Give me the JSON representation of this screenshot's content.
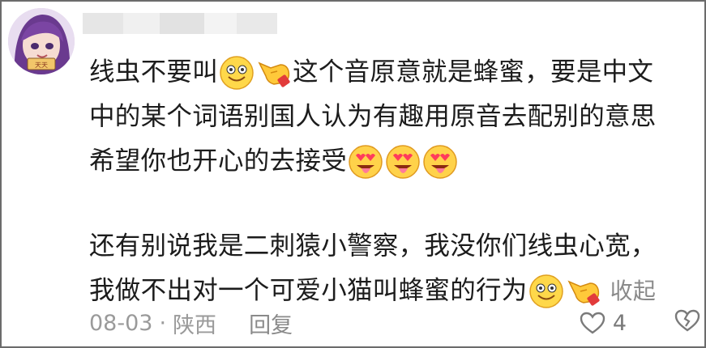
{
  "comment": {
    "line1_a": "线虫不要叫",
    "line1_b": "这个音原意就是蜂蜜，要是中文",
    "line2": "中的某个词语别国人认为有趣用原音去配别的意思",
    "line3": "希望你也开心的去接受",
    "line4": "还有别说我是二刺猿小警察，我没你们线虫心宽，",
    "line5": "我做不出对一个可爱小猫叫蜂蜜的行为",
    "collapse_label": "收起"
  },
  "footer": {
    "date": "08-03",
    "separator": "·",
    "location": "陕西",
    "reply_label": "回复",
    "like_count": "4"
  },
  "icons": {
    "smile": "smile-emoji",
    "pointing_hand": "pointing-hand-emoji",
    "heart_eyes": "heart-eyes-tongue-emoji",
    "like": "heart-icon",
    "dislike": "broken-heart-icon"
  },
  "colors": {
    "text": "#1c1c1c",
    "meta": "#9a9a9a",
    "border": "#6b6b6b"
  }
}
